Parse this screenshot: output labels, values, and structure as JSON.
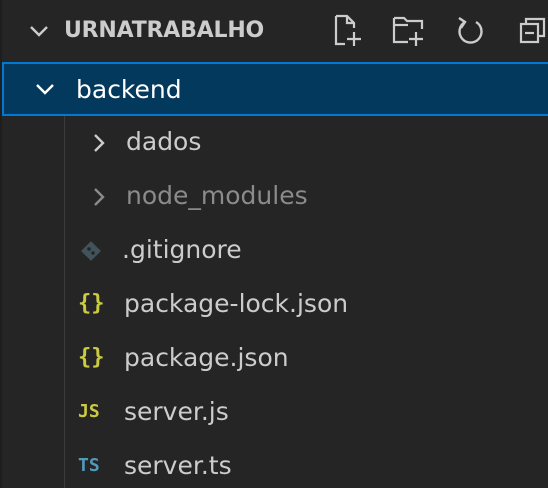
{
  "explorer": {
    "title": "URNATRABALHO",
    "actions": [
      "new-file-icon",
      "new-folder-icon",
      "refresh-icon",
      "collapse-all-icon"
    ]
  },
  "tree": {
    "root": {
      "label": "backend",
      "expanded": true
    },
    "items": [
      {
        "label": "dados",
        "type": "folder",
        "expanded": false
      },
      {
        "label": "node_modules",
        "type": "folder",
        "expanded": false,
        "ignored": true
      },
      {
        "label": ".gitignore",
        "type": "file",
        "icon": "git-icon"
      },
      {
        "label": "package-lock.json",
        "type": "file",
        "icon_text": "{}",
        "icon_color": "#cbcb41"
      },
      {
        "label": "package.json",
        "type": "file",
        "icon_text": "{}",
        "icon_color": "#cbcb41"
      },
      {
        "label": "server.js",
        "type": "file",
        "icon_text": "JS",
        "icon_color": "#cbcb41"
      },
      {
        "label": "server.ts",
        "type": "file",
        "icon_text": "TS",
        "icon_color": "#519aba"
      }
    ]
  },
  "colors": {
    "background": "#252526",
    "selection": "#04395e",
    "focus_border": "#0078d4",
    "text": "#cccccc"
  }
}
